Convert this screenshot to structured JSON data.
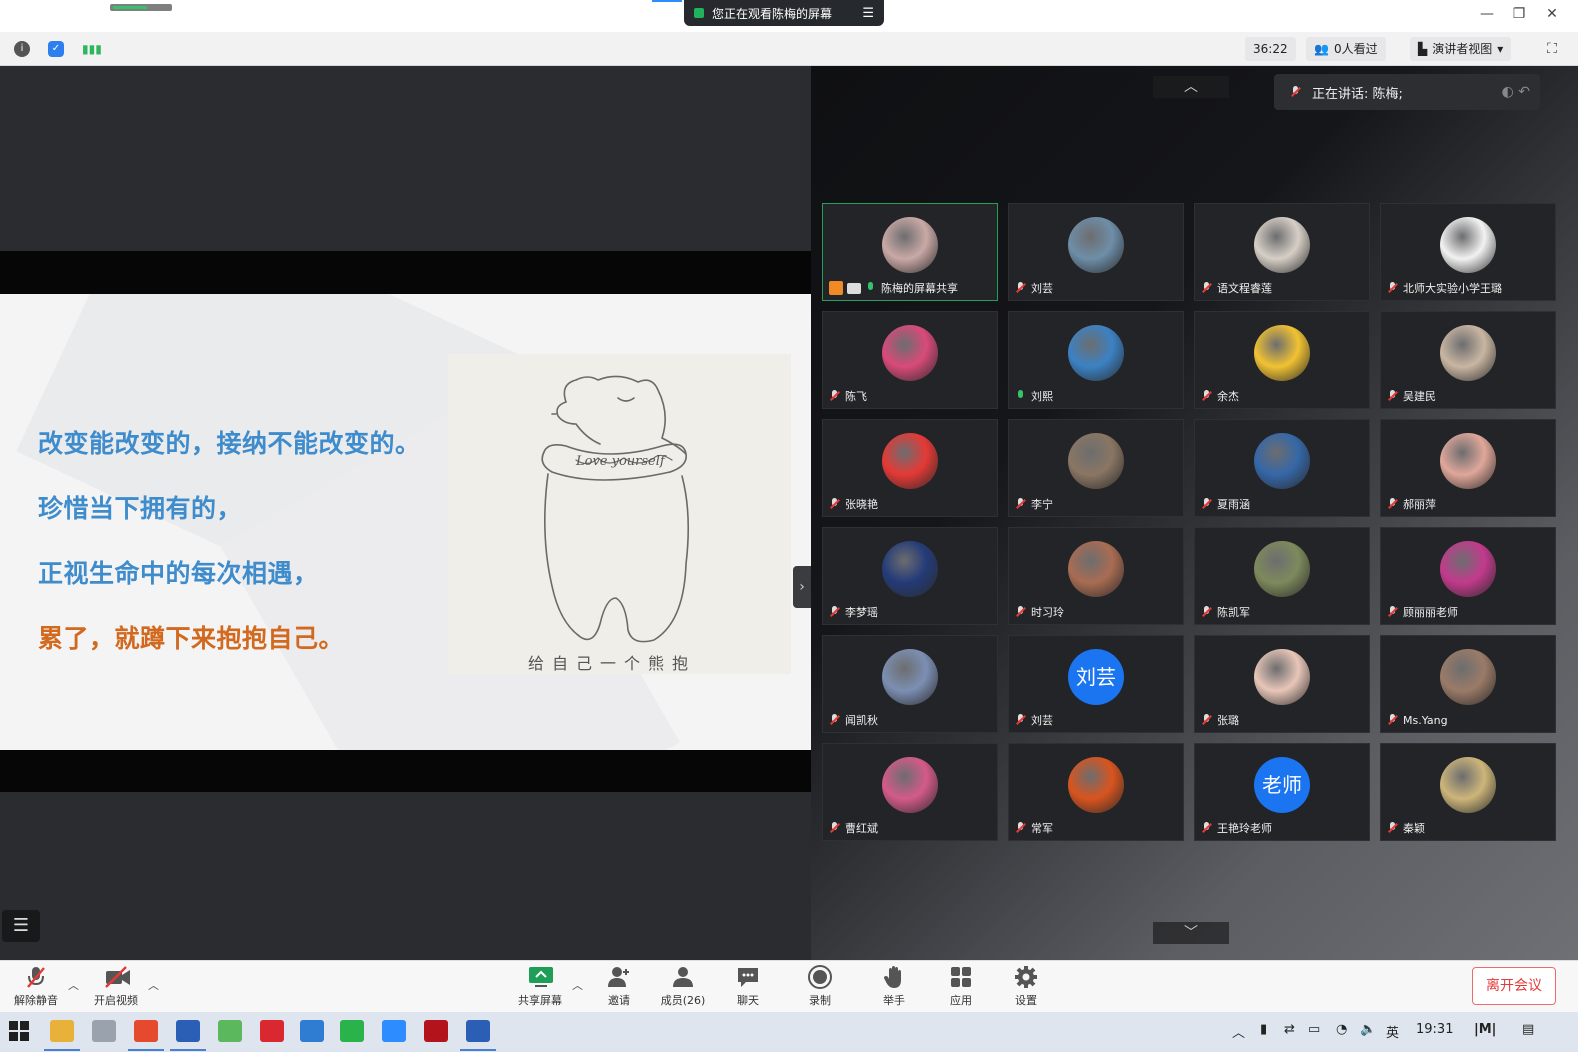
{
  "title_bar": {
    "share_notice": "您正在观看陈梅的屏幕",
    "window_controls": [
      "minimize-icon",
      "restore-icon",
      "close-icon"
    ]
  },
  "top_bar": {
    "timer": "36:22",
    "viewers": "0人看过",
    "view_mode": "演讲者视图",
    "icons": [
      "info-icon",
      "shield-icon",
      "signal-icon",
      "fullscreen-icon"
    ]
  },
  "slide": {
    "lines": [
      {
        "text": "改变能改变的，接纳不能改变的。",
        "color": "#3f8ccd"
      },
      {
        "text": "珍惜当下拥有的，",
        "color": "#3f8ccd"
      },
      {
        "text": "正视生命中的每次相遇，",
        "color": "#3f8ccd"
      },
      {
        "text": "累了，就蹲下来抱抱自己。",
        "color": "#d2691e"
      }
    ],
    "image_script_text": "Love yourself",
    "image_caption": "给自己一个熊抱"
  },
  "speaking_banner": "正在讲话: 陈梅;",
  "participants": [
    {
      "name": "陈梅的屏幕共享",
      "mic": "on",
      "avatar_color": "#c9a9a6",
      "avatar_text": ""
    },
    {
      "name": "刘芸",
      "mic": "muted",
      "avatar_color": "#6e8ea8",
      "avatar_text": ""
    },
    {
      "name": "语文程睿莲",
      "mic": "muted",
      "avatar_color": "#d7cfc6",
      "avatar_text": ""
    },
    {
      "name": "北师大实验小学王璐",
      "mic": "muted",
      "avatar_color": "#f2f2f2",
      "avatar_text": ""
    },
    {
      "name": "陈飞",
      "mic": "muted",
      "avatar_color": "#d94a79",
      "avatar_text": ""
    },
    {
      "name": "刘熙",
      "mic": "on-white",
      "avatar_color": "#3b82c4",
      "avatar_text": ""
    },
    {
      "name": "余杰",
      "mic": "muted",
      "avatar_color": "#f1c232",
      "avatar_text": ""
    },
    {
      "name": "吴建民",
      "mic": "muted",
      "avatar_color": "#c9b6a2",
      "avatar_text": ""
    },
    {
      "name": "张晓艳",
      "mic": "muted",
      "avatar_color": "#e53935",
      "avatar_text": ""
    },
    {
      "name": "李宁",
      "mic": "muted",
      "avatar_color": "#8a7663",
      "avatar_text": ""
    },
    {
      "name": "夏雨涵",
      "mic": "muted",
      "avatar_color": "#3567a8",
      "avatar_text": ""
    },
    {
      "name": "郝丽萍",
      "mic": "muted",
      "avatar_color": "#e0a79a",
      "avatar_text": ""
    },
    {
      "name": "李梦瑶",
      "mic": "muted",
      "avatar_color": "#243b78",
      "avatar_text": ""
    },
    {
      "name": "时习玲",
      "mic": "muted",
      "avatar_color": "#a96c52",
      "avatar_text": ""
    },
    {
      "name": "陈凯军",
      "mic": "muted",
      "avatar_color": "#7d8a5c",
      "avatar_text": ""
    },
    {
      "name": "顾丽丽老师",
      "mic": "muted",
      "avatar_color": "#c23a8c",
      "avatar_text": ""
    },
    {
      "name": "闻凯秋",
      "mic": "muted",
      "avatar_color": "#7c8fb3",
      "avatar_text": ""
    },
    {
      "name": "刘芸",
      "mic": "muted",
      "avatar_color": "#1b74f0",
      "avatar_text": "刘芸"
    },
    {
      "name": "张璐",
      "mic": "muted",
      "avatar_color": "#e8c6b8",
      "avatar_text": ""
    },
    {
      "name": "Ms.Yang",
      "mic": "muted",
      "avatar_color": "#9b7b68",
      "avatar_text": ""
    },
    {
      "name": "曹红斌",
      "mic": "muted",
      "avatar_color": "#d45a8a",
      "avatar_text": ""
    },
    {
      "name": "常军",
      "mic": "muted",
      "avatar_color": "#d9541e",
      "avatar_text": ""
    },
    {
      "name": "王艳玲老师",
      "mic": "muted",
      "avatar_color": "#1b74f0",
      "avatar_text": "老师"
    },
    {
      "name": "秦颖",
      "mic": "muted",
      "avatar_color": "#cdb57a",
      "avatar_text": ""
    }
  ],
  "meeting_toolbar": {
    "unmute": "解除静音",
    "start_video": "开启视频",
    "share_screen": "共享屏幕",
    "invite": "邀请",
    "members": "成员(26)",
    "chat": "聊天",
    "record": "录制",
    "raise_hand": "举手",
    "apps": "应用",
    "settings": "设置",
    "leave": "离开会议"
  },
  "taskbar": {
    "ime": "英",
    "clock": "19:31",
    "apps": [
      {
        "icon": "windows-start-icon",
        "color": "#1f1f1f"
      },
      {
        "icon": "file-explorer-icon",
        "color": "#e8b23a"
      },
      {
        "icon": "app-icon",
        "color": "#9aa3ad"
      },
      {
        "icon": "browser-icon",
        "color": "#e64a2e"
      },
      {
        "icon": "word-icon",
        "color": "#2b5fb5"
      },
      {
        "icon": "ie-icon",
        "color": "#5cb85c"
      },
      {
        "icon": "wps-icon",
        "color": "#d9282f"
      },
      {
        "icon": "photos-icon",
        "color": "#2f7dd3"
      },
      {
        "icon": "wechat-icon",
        "color": "#2ab24b"
      },
      {
        "icon": "tencent-meeting-icon",
        "color": "#2d8cff"
      },
      {
        "icon": "pdf-icon",
        "color": "#b3141c"
      },
      {
        "icon": "word-icon",
        "color": "#2b5fb5"
      }
    ]
  }
}
